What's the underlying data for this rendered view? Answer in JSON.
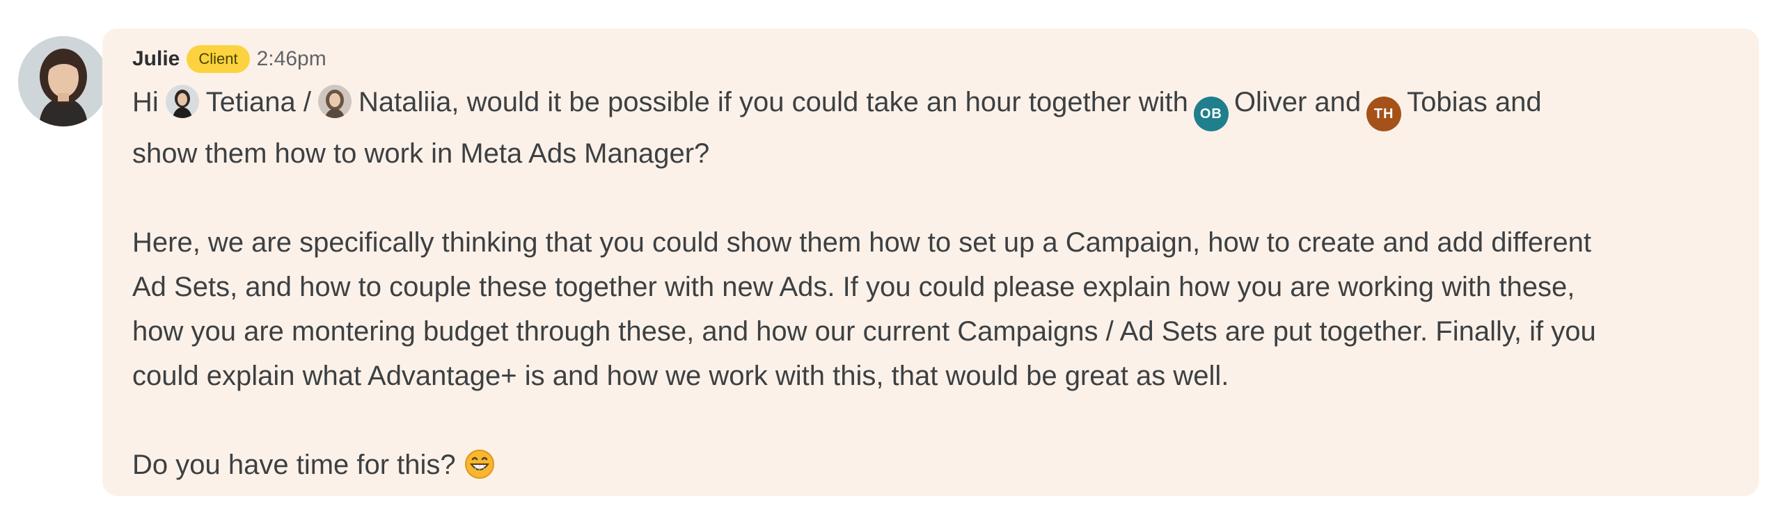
{
  "message": {
    "sender": "Julie",
    "badge": "Client",
    "time": "2:46pm",
    "paragraph1": {
      "lead": "Hi",
      "mention1": "Tetiana",
      "sep": "/",
      "mention2": "Nataliia",
      "text1": ", would it be possible if you could take an hour together with",
      "mention3": {
        "initials": "OB",
        "name": "Oliver",
        "color": "#1f7f8c"
      },
      "text2": "and",
      "mention4": {
        "initials": "TH",
        "name": "Tobias",
        "color": "#a4521a"
      },
      "text3": "and",
      "line2": "show them how to work in Meta Ads Manager?"
    },
    "paragraph2": {
      "line1": "Here, we are specifically thinking that you could show them how to set up a Campaign, how to create and add different",
      "line2": "Ad Sets, and how to couple these together with new Ads. If you could please explain how you are working with these,",
      "line3": "how you are montering budget through these, and how our current Campaigns / Ad Sets are put together. Finally, if you",
      "line4": "could explain what Advantage+ is and how we work with this, that would be great as well."
    },
    "paragraph3": {
      "text": "Do you have time for this?",
      "emoji": "grinning-face-emoji"
    }
  },
  "colors": {
    "bubble": "#fcf1e8",
    "badge": "#fcd33f",
    "text": "#3c4043"
  }
}
